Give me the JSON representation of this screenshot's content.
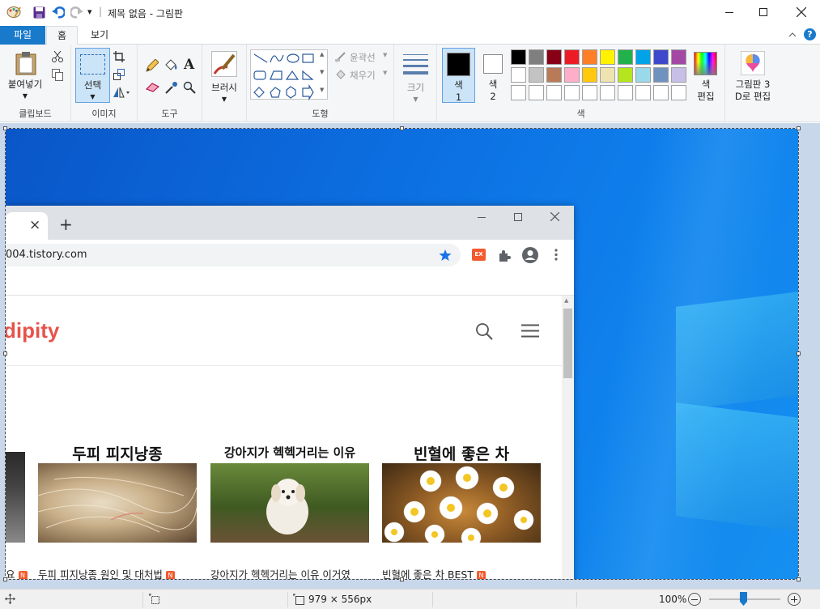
{
  "titlebar": {
    "title": "제목 없음 - 그림판",
    "separator": "|",
    "dropdown": "▾"
  },
  "tabs": {
    "file": "파일",
    "home": "홈",
    "view": "보기"
  },
  "groups": {
    "clipboard": "클립보드",
    "image": "이미지",
    "tools": "도구",
    "shapes": "도형",
    "colors": "색"
  },
  "clipboard": {
    "paste": "붙여넣기"
  },
  "image": {
    "select": "선택"
  },
  "brushes": {
    "label": "브러시"
  },
  "shapes": {
    "outline": "윤곽선",
    "fill": "채우기"
  },
  "size": {
    "label": "크기"
  },
  "color1": {
    "line1": "색",
    "line2": "1"
  },
  "color2": {
    "line1": "색",
    "line2": "2"
  },
  "editcolors": {
    "line1": "색",
    "line2": "편집"
  },
  "paint3d": {
    "line1": "그림판 3",
    "line2": "D로 편집"
  },
  "palette": {
    "row1": [
      "#000000",
      "#7f7f7f",
      "#880015",
      "#ed1c24",
      "#ff7f27",
      "#fff200",
      "#22b14c",
      "#00a2e8",
      "#3f48cc",
      "#a349a4"
    ],
    "row2": [
      "#ffffff",
      "#c3c3c3",
      "#b97a57",
      "#ffaec9",
      "#ffc90e",
      "#efe4b0",
      "#b5e61d",
      "#99d9ea",
      "#7092be",
      "#c8bfe7"
    ],
    "row3": [
      "#ffffff",
      "#ffffff",
      "#ffffff",
      "#ffffff",
      "#ffffff",
      "#ffffff",
      "#ffffff",
      "#ffffff",
      "#ffffff",
      "#ffffff"
    ]
  },
  "status": {
    "dimensions": "979 × 556px",
    "zoom": "100%"
  },
  "browser": {
    "tab_close": "×",
    "new_tab": "+",
    "url": "004.tistory.com",
    "ext_badge": "EX",
    "site_title": "dipity",
    "cards": [
      {
        "heading": "두피 피지낭종",
        "caption": "두피 피지낭종 원인 및 대처법",
        "badge": "N"
      },
      {
        "heading": "강아지가 헥헥거리는 이유",
        "caption": "강아지가 헥헥거리는 이유 이거였",
        "badge": "N"
      },
      {
        "heading": "빈혈에 좋은 차",
        "caption": "빈혈에 좋은 차 BEST",
        "badge": "N"
      }
    ],
    "partial_caption": "요",
    "partial_badge": "N"
  },
  "colors": {
    "accent": "#1979ca",
    "selected_bg": "#cce4f7",
    "site_title": "#e6534b"
  }
}
